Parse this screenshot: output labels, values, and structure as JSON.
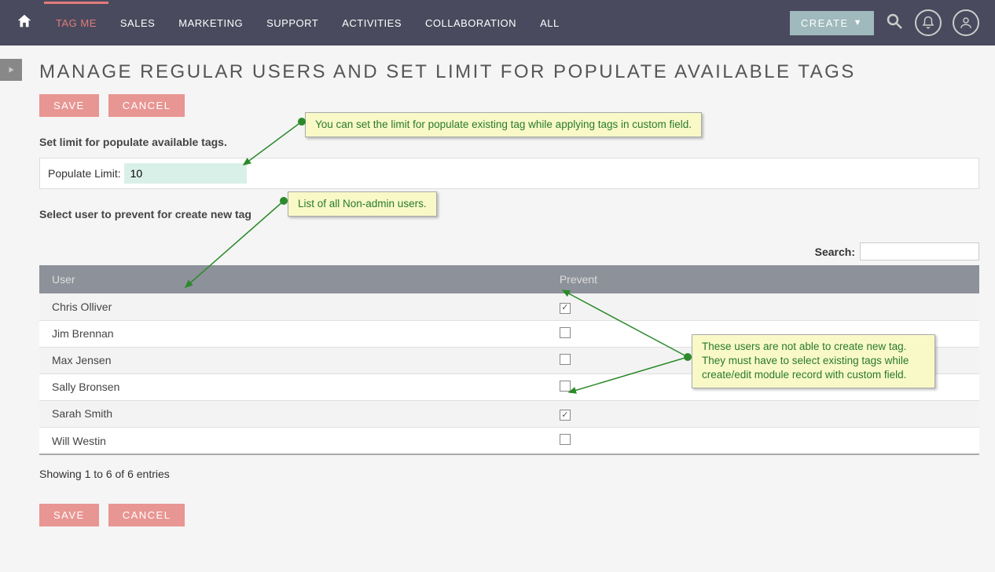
{
  "nav": {
    "items": [
      "TAG ME",
      "SALES",
      "MARKETING",
      "SUPPORT",
      "ACTIVITIES",
      "COLLABORATION",
      "ALL"
    ],
    "create": "CREATE"
  },
  "page": {
    "title": "MANAGE REGULAR USERS AND SET LIMIT FOR POPULATE AVAILABLE TAGS",
    "save": "SAVE",
    "cancel": "CANCEL",
    "section1": "Set limit for populate available tags.",
    "limit_label": "Populate Limit:",
    "limit_value": "10",
    "section2": "Select user to prevent for create new tag",
    "search_label": "Search:",
    "col_user": "User",
    "col_prevent": "Prevent",
    "entries": "Showing 1 to 6 of 6 entries"
  },
  "users": [
    {
      "name": "Chris Olliver",
      "checked": true
    },
    {
      "name": "Jim Brennan",
      "checked": false
    },
    {
      "name": "Max Jensen",
      "checked": false
    },
    {
      "name": "Sally Bronsen",
      "checked": false
    },
    {
      "name": "Sarah Smith",
      "checked": true
    },
    {
      "name": "Will Westin",
      "checked": false
    }
  ],
  "annotations": {
    "a1": "You can set the limit for populate existing tag while applying tags in custom field.",
    "a2": "List of all Non-admin users.",
    "a3": "These users are not able to create new tag. They must have to select existing tags while create/edit module record with custom field."
  }
}
